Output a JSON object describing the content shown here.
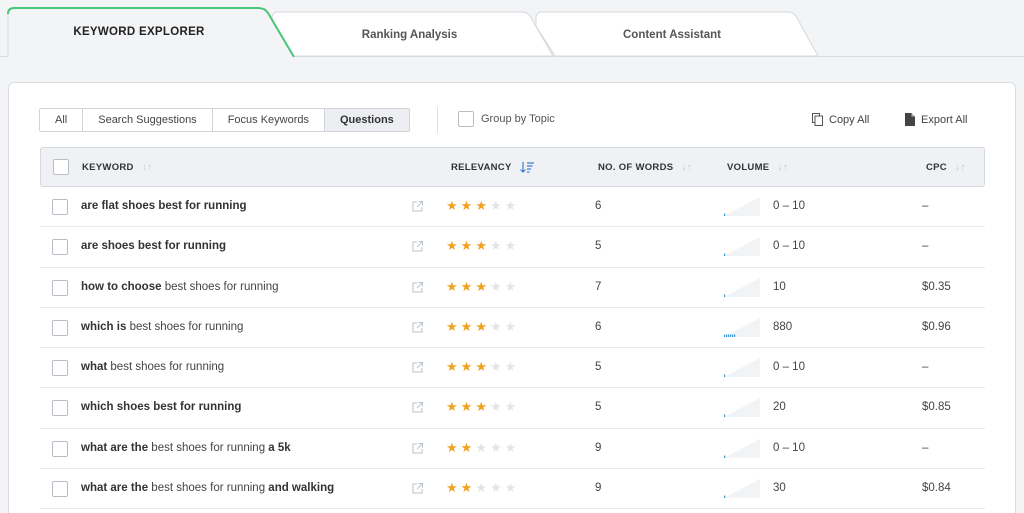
{
  "tabs": [
    {
      "label": "KEYWORD EXPLORER",
      "active": true
    },
    {
      "label": "Ranking Analysis",
      "active": false
    },
    {
      "label": "Content Assistant",
      "active": false
    }
  ],
  "colors": {
    "accent": "#49c57a",
    "star": "#f0a21e",
    "sort_active": "#3a7fd5"
  },
  "filters": [
    "All",
    "Search Suggestions",
    "Focus Keywords",
    "Questions"
  ],
  "active_filter": "Questions",
  "group_label": "Group by Topic",
  "actions": {
    "copy_all": "Copy All",
    "export_all": "Export All"
  },
  "columns": {
    "keyword": "KEYWORD",
    "relevancy": "RELEVANCY",
    "words": "NO. OF WORDS",
    "volume": "VOLUME",
    "cpc": "CPC"
  },
  "rows": [
    {
      "parts": [
        [
          "are flat shoes best for running",
          true
        ]
      ],
      "stars": 3,
      "words": "6",
      "volume": "0 – 10",
      "spark": 1,
      "cpc": "–"
    },
    {
      "parts": [
        [
          "are shoes best for running",
          true
        ]
      ],
      "stars": 3,
      "words": "5",
      "volume": "0 – 10",
      "spark": 1,
      "cpc": "–"
    },
    {
      "parts": [
        [
          "how to choose",
          true
        ],
        [
          " best shoes for running",
          false
        ]
      ],
      "stars": 3,
      "words": "7",
      "volume": "10",
      "spark": 2,
      "cpc": "$0.35"
    },
    {
      "parts": [
        [
          "which is",
          true
        ],
        [
          " best shoes for running",
          false
        ]
      ],
      "stars": 3,
      "words": "6",
      "volume": "880",
      "spark": 3,
      "cpc": "$0.96"
    },
    {
      "parts": [
        [
          "what",
          true
        ],
        [
          " best shoes for running",
          false
        ]
      ],
      "stars": 3,
      "words": "5",
      "volume": "0 – 10",
      "spark": 1,
      "cpc": "–"
    },
    {
      "parts": [
        [
          "which shoes best for running",
          true
        ]
      ],
      "stars": 3,
      "words": "5",
      "volume": "20",
      "spark": 2,
      "cpc": "$0.85"
    },
    {
      "parts": [
        [
          "what are the",
          true
        ],
        [
          " best shoes for running ",
          false
        ],
        [
          "a 5k",
          true
        ]
      ],
      "stars": 2,
      "words": "9",
      "volume": "0 – 10",
      "spark": 1,
      "cpc": "–"
    },
    {
      "parts": [
        [
          "what are the",
          true
        ],
        [
          " best shoes for running ",
          false
        ],
        [
          "and walking",
          true
        ]
      ],
      "stars": 2,
      "words": "9",
      "volume": "30",
      "spark": 2,
      "cpc": "$0.84"
    }
  ]
}
